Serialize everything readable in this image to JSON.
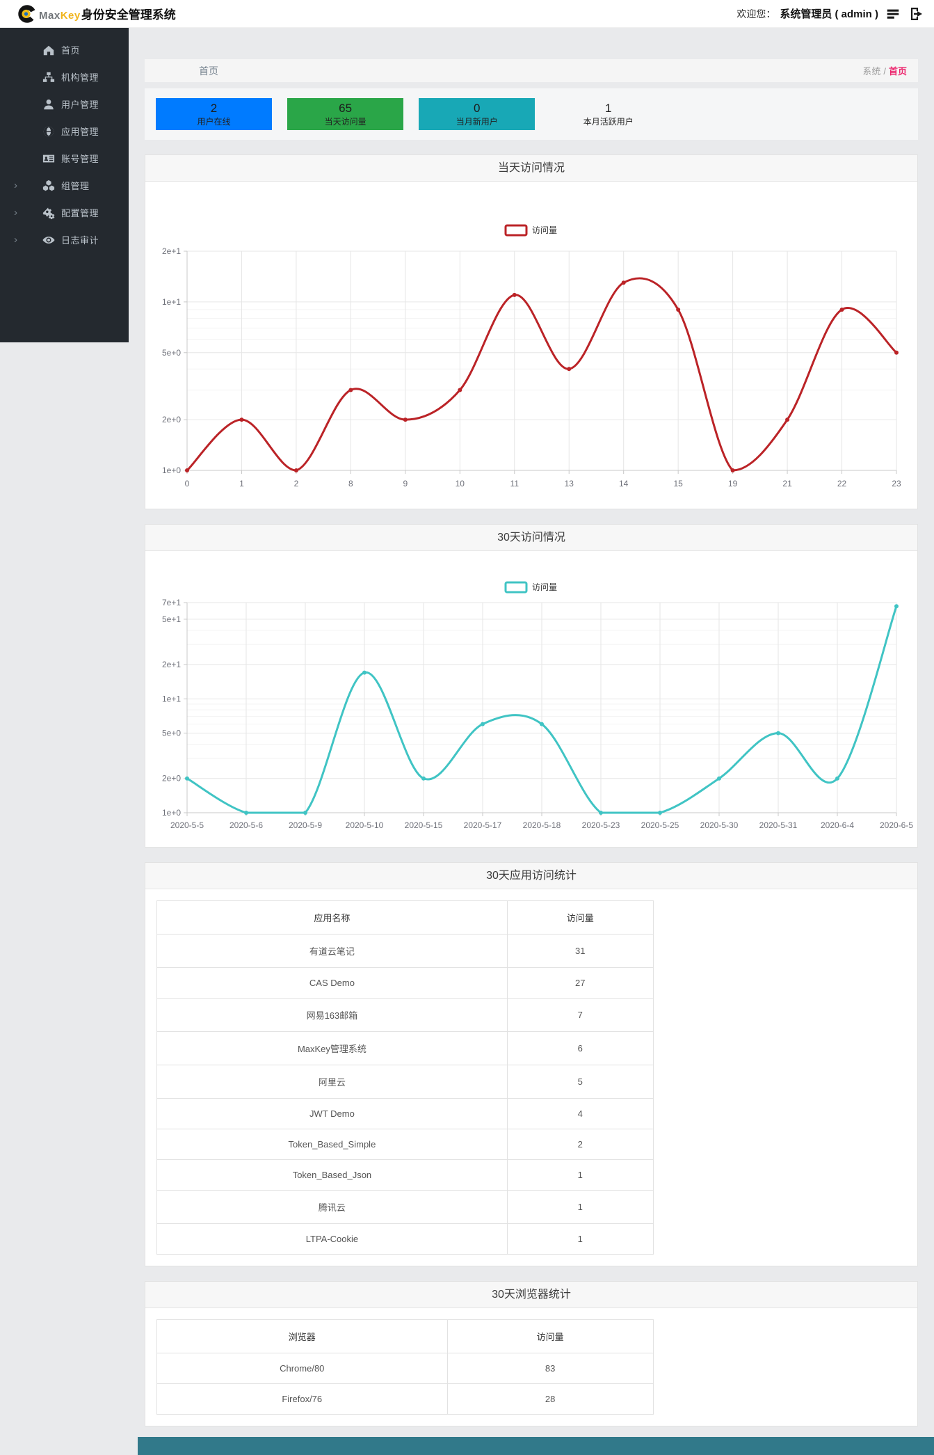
{
  "header": {
    "brand_max": "Max",
    "brand_key": "Key",
    "brand_suffix": "身份安全管理系统",
    "welcome_label": "欢迎您：",
    "user": "系统管理员 ( admin )"
  },
  "sidebar": {
    "items": [
      {
        "label": "首页",
        "icon": "home-icon",
        "expandable": false
      },
      {
        "label": "机构管理",
        "icon": "sitemap-icon",
        "expandable": false
      },
      {
        "label": "用户管理",
        "icon": "user-icon",
        "expandable": false
      },
      {
        "label": "应用管理",
        "icon": "globe-icon",
        "expandable": false
      },
      {
        "label": "账号管理",
        "icon": "id-card-icon",
        "expandable": false
      },
      {
        "label": "组管理",
        "icon": "cubes-icon",
        "expandable": true
      },
      {
        "label": "配置管理",
        "icon": "gears-icon",
        "expandable": true
      },
      {
        "label": "日志审计",
        "icon": "eye-icon",
        "expandable": true
      }
    ],
    "expand_glyph": "›"
  },
  "breadcrumb": {
    "page_title": "首页",
    "parent": "系统",
    "separator": "/",
    "current": "首页",
    "current_color": "#ec256d"
  },
  "stats": [
    {
      "value": "2",
      "label": "用户在线",
      "bg": "#007bff"
    },
    {
      "value": "65",
      "label": "当天访问量",
      "bg": "#2aa648"
    },
    {
      "value": "0",
      "label": "当月新用户",
      "bg": "#18a8b6"
    },
    {
      "value": "1",
      "label": "本月活跃用户",
      "bg": "transparent"
    }
  ],
  "panels": {
    "today": "当天访问情况",
    "monthly": "30天访问情况",
    "apps": "30天应用访问统计",
    "browsers": "30天浏览器统计"
  },
  "chart_data": [
    {
      "type": "line",
      "title": "当天访问情况",
      "legend": "访问量",
      "color": "#bb2327",
      "log_scale": true,
      "ylim": [
        1,
        20
      ],
      "yticks": [
        [
          20,
          "2e+1"
        ],
        [
          10,
          "1e+1"
        ],
        [
          5,
          "5e+0"
        ],
        [
          2,
          "2e+0"
        ],
        [
          1,
          "1e+0"
        ]
      ],
      "minor_ticks": [
        9,
        8,
        7,
        6,
        4,
        3
      ],
      "categories": [
        "0",
        "1",
        "2",
        "8",
        "9",
        "10",
        "11",
        "13",
        "14",
        "15",
        "19",
        "21",
        "22",
        "23"
      ],
      "values": [
        1,
        2,
        1,
        3,
        2,
        3,
        11,
        4,
        13,
        9,
        1,
        2,
        9,
        5
      ]
    },
    {
      "type": "line",
      "title": "30天访问情况",
      "legend": "访问量",
      "color": "#40c4c4",
      "log_scale": true,
      "ylim": [
        1,
        70
      ],
      "yticks": [
        [
          70,
          "7e+1"
        ],
        [
          50,
          "5e+1"
        ],
        [
          20,
          "2e+1"
        ],
        [
          10,
          "1e+1"
        ],
        [
          5,
          "5e+0"
        ],
        [
          2,
          "2e+0"
        ],
        [
          1,
          "1e+0"
        ]
      ],
      "minor_ticks": [
        40,
        30,
        9,
        8,
        7,
        6,
        4,
        3
      ],
      "categories": [
        "2020-5-5",
        "2020-5-6",
        "2020-5-9",
        "2020-5-10",
        "2020-5-15",
        "2020-5-17",
        "2020-5-18",
        "2020-5-23",
        "2020-5-25",
        "2020-5-30",
        "2020-5-31",
        "2020-6-4",
        "2020-6-5"
      ],
      "values": [
        2,
        1,
        1,
        17,
        2,
        6,
        6,
        1,
        1,
        2,
        5,
        2,
        65
      ]
    }
  ],
  "app_table": {
    "headers": [
      "应用名称",
      "访问量"
    ],
    "rows": [
      [
        "有道云笔记",
        "31"
      ],
      [
        "CAS Demo",
        "27"
      ],
      [
        "网易163邮箱",
        "7"
      ],
      [
        "MaxKey管理系统",
        "6"
      ],
      [
        "阿里云",
        "5"
      ],
      [
        "JWT Demo",
        "4"
      ],
      [
        "Token_Based_Simple",
        "2"
      ],
      [
        "Token_Based_Json",
        "1"
      ],
      [
        "腾讯云",
        "1"
      ],
      [
        "LTPA-Cookie",
        "1"
      ]
    ]
  },
  "browser_table": {
    "headers": [
      "浏览器",
      "访问量"
    ],
    "rows": [
      [
        "Chrome/80",
        "83"
      ],
      [
        "Firefox/76",
        "28"
      ]
    ]
  }
}
